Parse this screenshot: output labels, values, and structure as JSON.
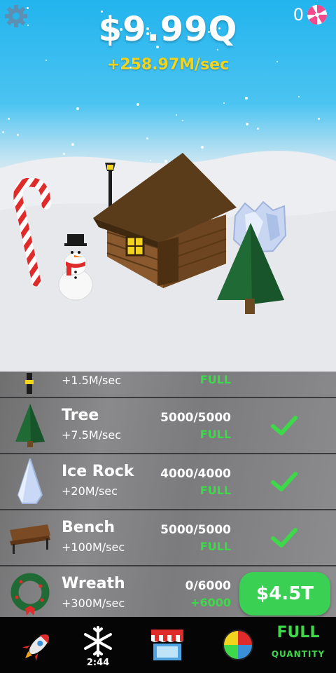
{
  "hud": {
    "money": "$9.99Q",
    "rate": "+258.97M/sec",
    "candy_count": "0"
  },
  "items": [
    {
      "name": "",
      "income": "+1.5M/sec",
      "count": "",
      "status": "FULL",
      "icon": "lamp-post-icon"
    },
    {
      "name": "Tree",
      "income": "+7.5M/sec",
      "count": "5000/5000",
      "status": "FULL",
      "icon": "tree-icon"
    },
    {
      "name": "Ice Rock",
      "income": "+20M/sec",
      "count": "4000/4000",
      "status": "FULL",
      "icon": "ice-rock-icon"
    },
    {
      "name": "Bench",
      "income": "+100M/sec",
      "count": "5000/5000",
      "status": "FULL",
      "icon": "bench-icon"
    },
    {
      "name": "Wreath",
      "income": "+300M/sec",
      "count": "0/6000",
      "status": "+6000",
      "icon": "wreath-icon"
    }
  ],
  "buy_button": "$4.5T",
  "tabbar": {
    "timer": "2:44",
    "quantity_value": "FULL",
    "quantity_label": "QUANTITY"
  },
  "colors": {
    "sky": "#22b4ee",
    "rate_yellow": "#f2d41e",
    "accent_green": "#3ed94a",
    "buy_green": "#3ad053"
  }
}
